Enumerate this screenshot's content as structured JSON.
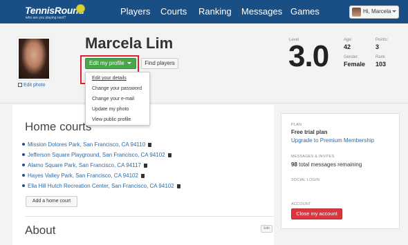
{
  "brand": {
    "name": "TennisRound",
    "tagline": "who are you playing next?"
  },
  "nav": {
    "items": [
      "Players",
      "Courts",
      "Ranking",
      "Messages",
      "Games"
    ]
  },
  "user_menu": {
    "label": "Hi, Marcela"
  },
  "profile": {
    "name": "Marcela Lim",
    "edit_photo": "Edit photo",
    "edit_profile_button": "Edit my profile",
    "find_players_button": "Find players"
  },
  "dropdown": {
    "items": [
      "Edit your details",
      "Change your password",
      "Change your e-mail",
      "Update my photo",
      "View public profile"
    ]
  },
  "stats": {
    "level_label": "Level",
    "level": "3.0",
    "age_label": "Age:",
    "age": "42",
    "points_label": "Points:",
    "points": "3",
    "gender_label": "Gender:",
    "gender": "Female",
    "rank_label": "Rank",
    "rank": "103"
  },
  "home_courts": {
    "title": "Home courts",
    "courts": [
      "Mission Dolores Park, San Francisco, CA 94110",
      "Jefferson Square Playground, San Francisco, CA 94102",
      "Alamo Square Park, San Francisco, CA 94117",
      "Hayes Valley Park, San Francisco, CA 94102",
      "Ella Hill Hutch Recreation Center, San Francisco, CA 94102"
    ],
    "add_button": "Add a home court"
  },
  "about": {
    "title": "About",
    "edit_button": "Edit"
  },
  "account_panel": {
    "plan_label": "PLAN",
    "plan_value": "Free trial plan",
    "upgrade_link": "Upgrade to Premium Membership",
    "messages_label": "MESSAGES & INVITES",
    "messages_count": "98",
    "messages_text": "total messages remaining",
    "social_label": "SOCIAL LOGIN",
    "account_label": "ACCOUNT",
    "close_button": "Close my account"
  },
  "colors": {
    "nav_bg": "#1a4f85",
    "primary_button": "#4aa64a",
    "danger_button": "#d9363e",
    "link": "#2a6aa8",
    "highlight": "#e0202a"
  }
}
